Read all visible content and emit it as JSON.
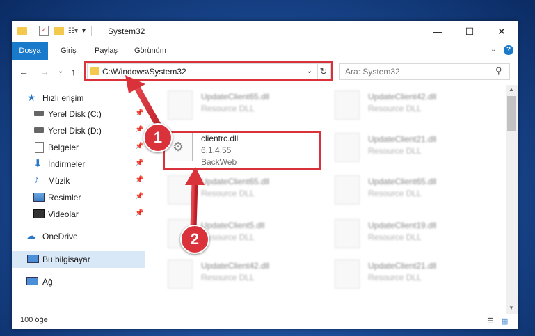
{
  "window": {
    "title": "System32"
  },
  "ribbon": {
    "tabs": [
      "Dosya",
      "Giriş",
      "Paylaş",
      "Görünüm"
    ]
  },
  "address": {
    "path": "C:\\Windows\\System32"
  },
  "search": {
    "placeholder": "Ara: System32"
  },
  "nav": {
    "quick_access": "Hızlı erişim",
    "items": [
      "Yerel Disk (C:)",
      "Yerel Disk (D:)",
      "Belgeler",
      "İndirmeler",
      "Müzik",
      "Resimler",
      "Videolar"
    ],
    "onedrive": "OneDrive",
    "this_pc": "Bu bilgisayar",
    "network": "Ağ"
  },
  "files": {
    "highlighted": {
      "name": "clientrc.dll",
      "version": "6.1.4.55",
      "company": "BackWeb"
    },
    "left_col": [
      {
        "name": "UpdateClient65.dll",
        "type": "Resource DLL"
      },
      {
        "name": "UpdateClient65.dll",
        "type": "Resource DLL"
      },
      {
        "name": "UpdateClient5.dll",
        "type": "Resource DLL"
      },
      {
        "name": "UpdateClient42.dll",
        "type": "Resource DLL"
      }
    ],
    "right_col": [
      {
        "name": "UpdateClient42.dll",
        "type": "Resource DLL"
      },
      {
        "name": "UpdateClient21.dll",
        "type": "Resource DLL"
      },
      {
        "name": "UpdateClient65.dll",
        "type": "Resource DLL"
      },
      {
        "name": "UpdateClient19.dll",
        "type": "Resource DLL"
      },
      {
        "name": "UpdateClient21.dll",
        "type": "Resource DLL"
      }
    ]
  },
  "status": {
    "item_count": "100 öğe"
  },
  "callouts": {
    "step1": "1",
    "step2": "2"
  },
  "colors": {
    "accent": "#1979ca",
    "highlight_red": "#d9323a"
  }
}
